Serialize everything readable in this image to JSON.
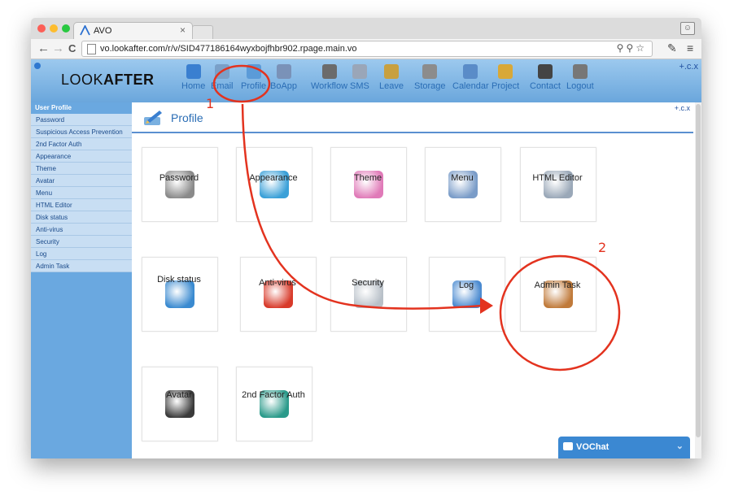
{
  "browser": {
    "tab_title": "AVO",
    "tab_close": "×",
    "url": "vo.lookafter.com/r/v/SID477186164wyxbojfhbr902.rpage.main.vo",
    "back_icon": "←",
    "forward_icon": "→",
    "reload_icon": "C",
    "menu_icon": "≡"
  },
  "app": {
    "logo_light": "LOOK",
    "logo_bold": "AFTER",
    "corner_link": "+.c.x",
    "nav": [
      {
        "label": "Home",
        "icon": "home-icon",
        "color": "#3a7fd0"
      },
      {
        "label": "Email",
        "icon": "email-icon",
        "color": "#7aa0c8"
      },
      {
        "label": "Profile",
        "icon": "profile-icon",
        "color": "#5b9bd8"
      },
      {
        "label": "BoApp",
        "icon": "boapp-icon",
        "color": "#7a92b8"
      },
      {
        "label": "Workflow",
        "icon": "workflow-icon",
        "color": "#6b6b6b"
      },
      {
        "label": "SMS",
        "icon": "sms-icon",
        "color": "#9aa6b8"
      },
      {
        "label": "Leave",
        "icon": "leave-icon",
        "color": "#c8a040"
      },
      {
        "label": "Storage",
        "icon": "storage-icon",
        "color": "#8c8c8c"
      },
      {
        "label": "Calendar",
        "icon": "calendar-icon",
        "color": "#5a8cc8"
      },
      {
        "label": "Project",
        "icon": "project-icon",
        "color": "#d8a838"
      },
      {
        "label": "Contact",
        "icon": "contact-icon",
        "color": "#444"
      },
      {
        "label": "Logout",
        "icon": "logout-icon",
        "color": "#777"
      }
    ]
  },
  "sidebar": {
    "header": "User Profile",
    "items": [
      "Password",
      "Suspicious Access Prevention",
      "2nd Factor Auth",
      "Appearance",
      "Theme",
      "Avatar",
      "Menu",
      "HTML Editor",
      "Disk status",
      "Anti-virus",
      "Security",
      "Log",
      "Admin Task"
    ]
  },
  "main": {
    "title": "Profile",
    "small_link": "+.c.x",
    "tiles": [
      {
        "label": "Password",
        "icon": "padlock-user-icon",
        "color": "#8a8a8a"
      },
      {
        "label": "Appearance",
        "icon": "monitor-globe-icon",
        "color": "#3aa0d8"
      },
      {
        "label": "Theme",
        "icon": "color-grid-icon",
        "color": "#e07ab8"
      },
      {
        "label": "Menu",
        "icon": "window-menu-icon",
        "color": "#7a9cc8"
      },
      {
        "label": "HTML Editor",
        "icon": "html-pen-icon",
        "color": "#9aa8b8"
      },
      {
        "label": "Disk status",
        "icon": "disk-chart-icon",
        "color": "#3a8ad0"
      },
      {
        "label": "Anti-virus",
        "icon": "shield-icon",
        "color": "#d83a2a"
      },
      {
        "label": "Security",
        "icon": "security-window-icon",
        "color": "#b8c0c8"
      },
      {
        "label": "Log",
        "icon": "log-globe-icon",
        "color": "#4a8ad0"
      },
      {
        "label": "Admin Task",
        "icon": "admin-key-icon",
        "color": "#c07a3a"
      },
      {
        "label": "Avatar",
        "icon": "avatar-silhouette-icon",
        "color": "#3a3a3a"
      },
      {
        "label": "2nd Factor Auth",
        "icon": "lock-badge-icon",
        "color": "#2a9a8a"
      }
    ]
  },
  "chat": {
    "label": "VOChat",
    "chevron": "⌄"
  },
  "annotations": {
    "step1": "1",
    "step2": "2"
  }
}
